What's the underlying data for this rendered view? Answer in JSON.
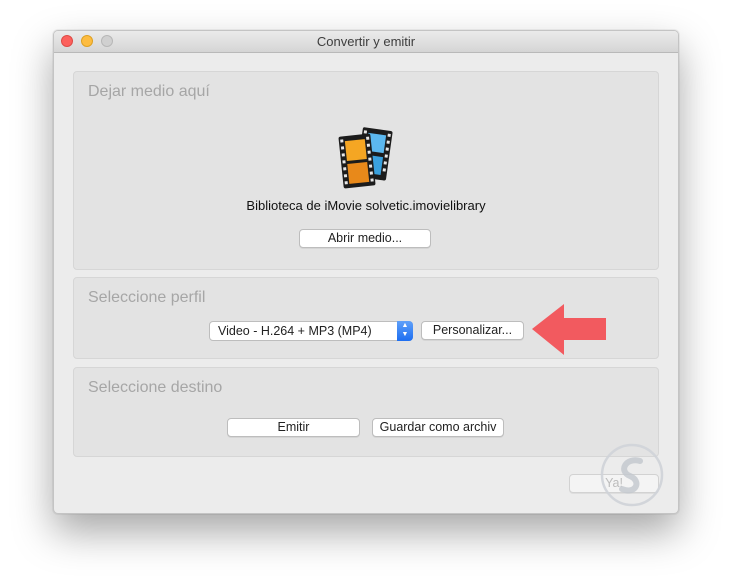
{
  "window": {
    "title": "Convertir y emitir"
  },
  "drop": {
    "label": "Dejar medio aquí",
    "icon": "film-strip-icon",
    "media_name": "Biblioteca de iMovie solvetic.imovielibrary",
    "open_button": "Abrir medio..."
  },
  "profile": {
    "label": "Seleccione perfil",
    "selected": "Video - H.264 + MP3 (MP4)",
    "customize_button": "Personalizar..."
  },
  "destination": {
    "label": "Seleccione destino",
    "stream_button": "Emitir",
    "save_button": "Guardar como archiv"
  },
  "footer": {
    "go_button": "Ya!"
  },
  "colors": {
    "accent": "#1d6ef1",
    "close": "#fc605c",
    "minimize": "#fdbc40",
    "annotation_arrow": "#f25a5f"
  }
}
